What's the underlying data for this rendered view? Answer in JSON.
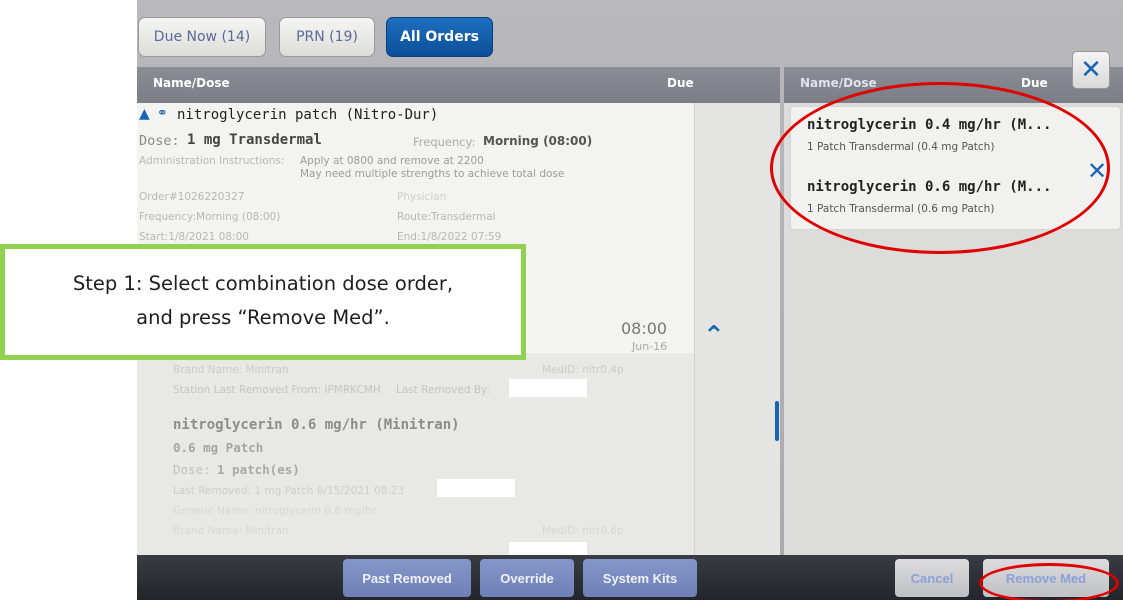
{
  "tabs": [
    {
      "label": "Due Now (14)"
    },
    {
      "label": "PRN (19)"
    },
    {
      "label": "All Orders"
    }
  ],
  "left_header": {
    "name_col": "Name/Dose",
    "due_col": "Due"
  },
  "right_header": {
    "name_col": "Name/Dose",
    "due_col": "Due"
  },
  "order": {
    "name": "nitroglycerin patch (Nitro-Dur)",
    "dose_label": "Dose:",
    "dose_value": "1 mg Transdermal",
    "frequency_label": "Frequency:",
    "frequency_value": "Morning (08:00)",
    "instructions_label": "Administration Instructions:",
    "instructions_line1": "Apply at 0800 and remove at 2200",
    "instructions_line2": "May need multiple strengths to achieve total dose",
    "order_number": "Order#1026220327",
    "physician_label": "Physician",
    "frequency_detail": "Frequency:Morning (08:00)",
    "route": "Route:Transdermal",
    "start": "Start:1/8/2021 08:00",
    "end": "End:1/8/2022 07:59",
    "due_time": "08:00",
    "due_date": "Jun-16"
  },
  "components": [
    {
      "brand": "Brand Name: Minitran",
      "medid": "MedID: nitr0.4p",
      "station": "Station Last Removed From: IPMRKCMH",
      "last_removed_by": "Last Removed By:"
    },
    {
      "name": "nitroglycerin 0.6 mg/hr (Minitran)",
      "strength": "0.6 mg Patch",
      "dose_label": "Dose:",
      "dose_value": "1 patch(es)",
      "last_removed": "Last Removed: 1 mg Patch 6/15/2021 08:23",
      "generic": "Generic Name: nitroglycerin 0.6 mg/hr",
      "brand": "Brand Name: Minitran",
      "medid": "MedID: nitr0.6p"
    }
  ],
  "selected": [
    {
      "name": "nitroglycerin 0.4 mg/hr (M...",
      "detail": "1 Patch Transdermal (0.4 mg Patch)"
    },
    {
      "name": "nitroglycerin 0.6 mg/hr (M...",
      "detail": "1 Patch Transdermal (0.6 mg Patch)"
    }
  ],
  "bottom_buttons": {
    "past_removed": "Past Removed",
    "override": "Override",
    "system_kits": "System Kits",
    "cancel": "Cancel",
    "remove_med": "Remove Med"
  },
  "callout": {
    "line1": "Step 1:  Select combination dose order,",
    "line2": "and press “Remove Med”."
  },
  "icons": {
    "close": "close-icon",
    "warning": "warning-icon",
    "combination": "combination-icon",
    "chevron": "chevron-up-icon"
  },
  "colors": {
    "callout_border": "#92d050",
    "annotation_red": "#e00000",
    "accent_blue": "#1a63b5"
  }
}
